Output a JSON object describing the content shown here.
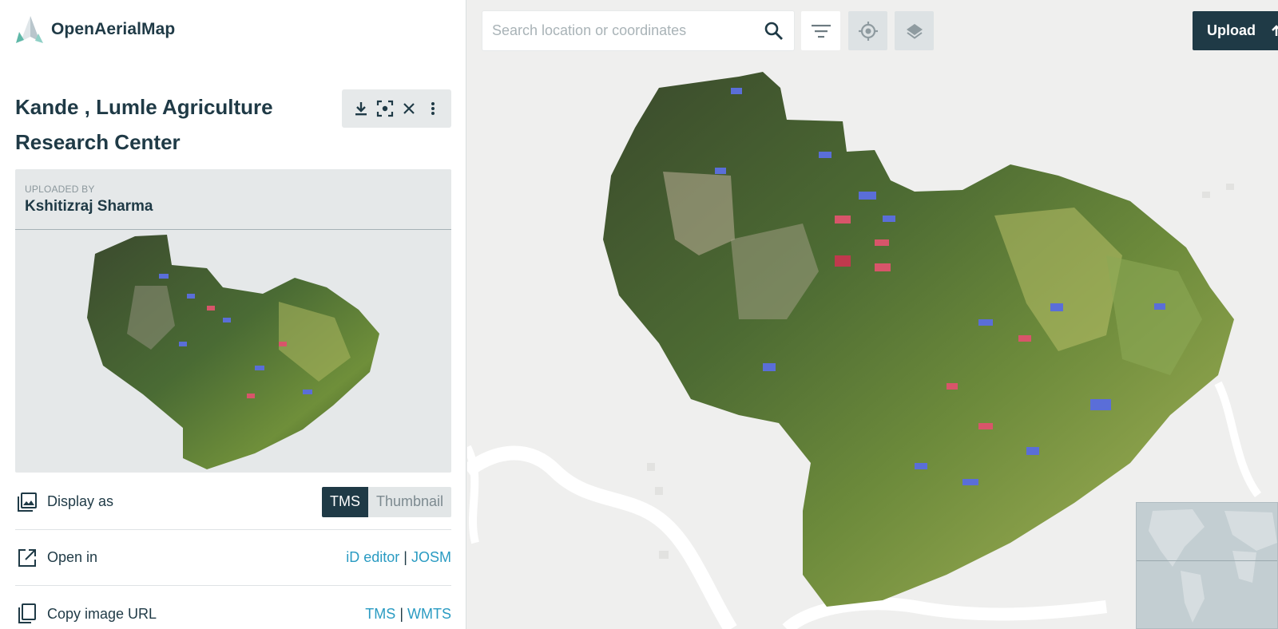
{
  "app": {
    "name": "OpenAerialMap"
  },
  "image": {
    "title": "Kande , Lumle Agriculture Research Center",
    "uploaded_by_label": "UPLOADED BY",
    "uploader": "Kshitizraj Sharma"
  },
  "actions": {
    "icons": [
      "download-icon",
      "zoom-to-fit-icon",
      "close-icon",
      "more-vert-icon"
    ]
  },
  "display_as": {
    "label": "Display as",
    "options": [
      "TMS",
      "Thumbnail"
    ],
    "selected": "TMS"
  },
  "open_in": {
    "label": "Open in",
    "link_1": "iD editor",
    "separator": "|",
    "link_2": "JOSM"
  },
  "copy_url": {
    "label": "Copy image URL",
    "link_1": "TMS",
    "separator": "|",
    "link_2": "WMTS"
  },
  "toolbar": {
    "search_placeholder": "Search location or coordinates",
    "upload_label": "Upload"
  },
  "colors": {
    "primary": "#1f3a46",
    "link": "#2a9bc2",
    "accent_logo": "#5fb8a8"
  }
}
